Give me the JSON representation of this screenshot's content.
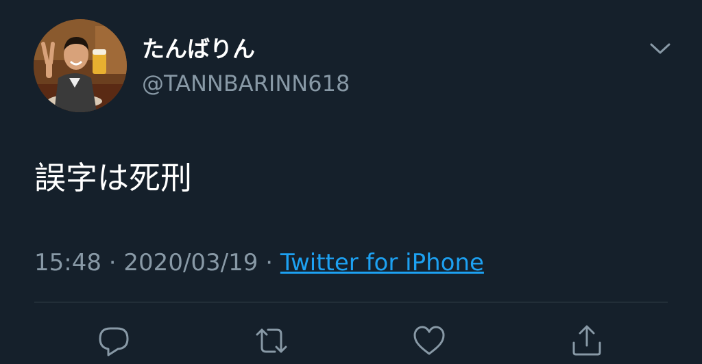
{
  "tweet": {
    "author": {
      "display_name": "たんばりん",
      "handle": "@TANNBARINN618"
    },
    "text": "誤字は死刑",
    "time": "15:48",
    "separator": "·",
    "date": "2020/03/19",
    "source": "Twitter for iPhone"
  },
  "icons": {
    "menu": "chevron-down-icon",
    "reply": "reply-icon",
    "retweet": "retweet-icon",
    "like": "heart-icon",
    "share": "share-icon"
  },
  "colors": {
    "background": "#15202b",
    "primary_text": "#ffffff",
    "secondary_text": "#8899a6",
    "link": "#1da1f2",
    "divider": "#38444d"
  }
}
